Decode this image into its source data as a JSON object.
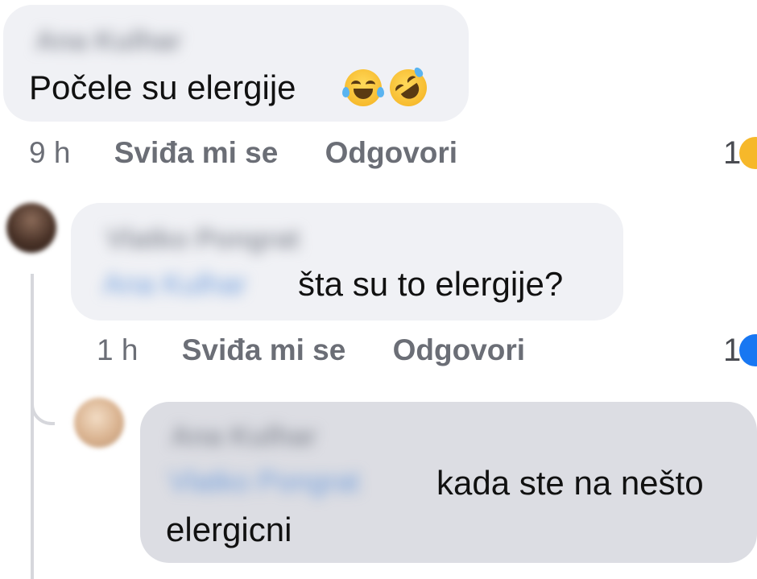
{
  "comments": [
    {
      "author": "Ana Kulhar",
      "text": "Počele su elergije",
      "emojis": [
        "face-with-tears-of-joy",
        "rolling-on-floor-laughing"
      ],
      "time": "9 h",
      "like_label": "Sviđa mi se",
      "reply_label": "Odgovori",
      "reaction_count": "1",
      "reaction_color": "#f6b82a"
    },
    {
      "author": "Vlatko Pongrat",
      "mention": "Ana Kulhar",
      "text": "šta su to elergije?",
      "time": "1 h",
      "like_label": "Sviđa mi se",
      "reply_label": "Odgovori",
      "reaction_count": "1",
      "reaction_color": "#1877f2"
    },
    {
      "author": "Ana Kulhar",
      "mention": "Vlatko Pongrat",
      "text_line1": "kada ste na nešto",
      "text_line2": "elergicni"
    }
  ],
  "colors": {
    "bubble": "#f0f1f5",
    "bubble_selected": "#dcdde3",
    "meta_text": "#6b6e76",
    "mention": "#6f9ddc"
  }
}
